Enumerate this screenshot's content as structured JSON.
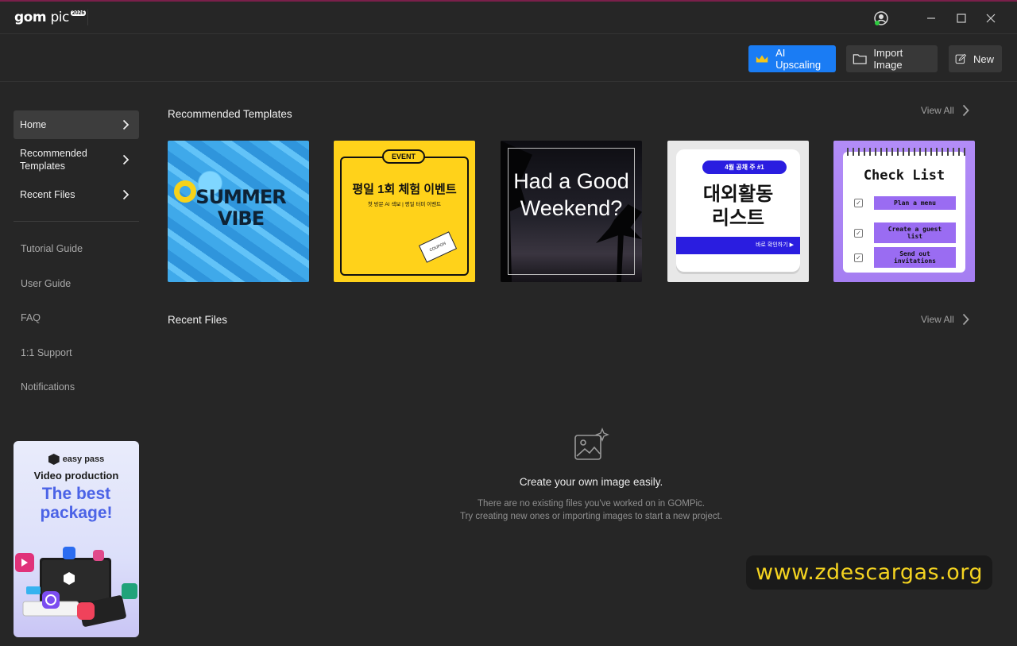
{
  "app": {
    "name_bold": "gom",
    "name_light": "pic",
    "badge": "2026"
  },
  "toolbar": {
    "ai_upscaling": "AI Upscaling",
    "import_image": "Import Image",
    "new": "New"
  },
  "sidebar": {
    "nav": [
      {
        "label": "Home"
      },
      {
        "label": "Recommended Templates"
      },
      {
        "label": "Recent Files"
      }
    ],
    "links": [
      "Tutorial Guide",
      "User Guide",
      "FAQ",
      "1:1 Support",
      "Notifications"
    ],
    "ad": {
      "brand": "easy pass",
      "line1": "Video production",
      "line2": "The best package!"
    }
  },
  "sections": {
    "recommended_title": "Recommended Templates",
    "recent_title": "Recent Files",
    "view_all": "View All"
  },
  "templates": {
    "summer": "SUMMER VIBE",
    "event_badge": "EVENT",
    "event_title": "평일 1회 체험 이벤트",
    "event_sub": "첫 방문 AI 색보 | 평일 터미 이벤트",
    "event_coupon": "COUPON",
    "weekend": "Had a Good Weekend?",
    "activity_pill": "4월 공채 주 #1",
    "activity_title": "대외활동 리스트",
    "activity_bar": "바로 확인하기 ▶",
    "check_title": "Check List",
    "check_items": [
      "Plan a menu",
      "Create a guest list",
      "Send out invitations"
    ]
  },
  "empty": {
    "title": "Create your own image easily.",
    "line1": "There are no existing files you've worked on in GOMPic.",
    "line2": "Try creating new ones or importing images to start a new project."
  },
  "watermark": "www.zdescargas.org",
  "colors": {
    "accent": "#1a7cf4",
    "background": "#262626",
    "watermark": "#f4d320"
  }
}
